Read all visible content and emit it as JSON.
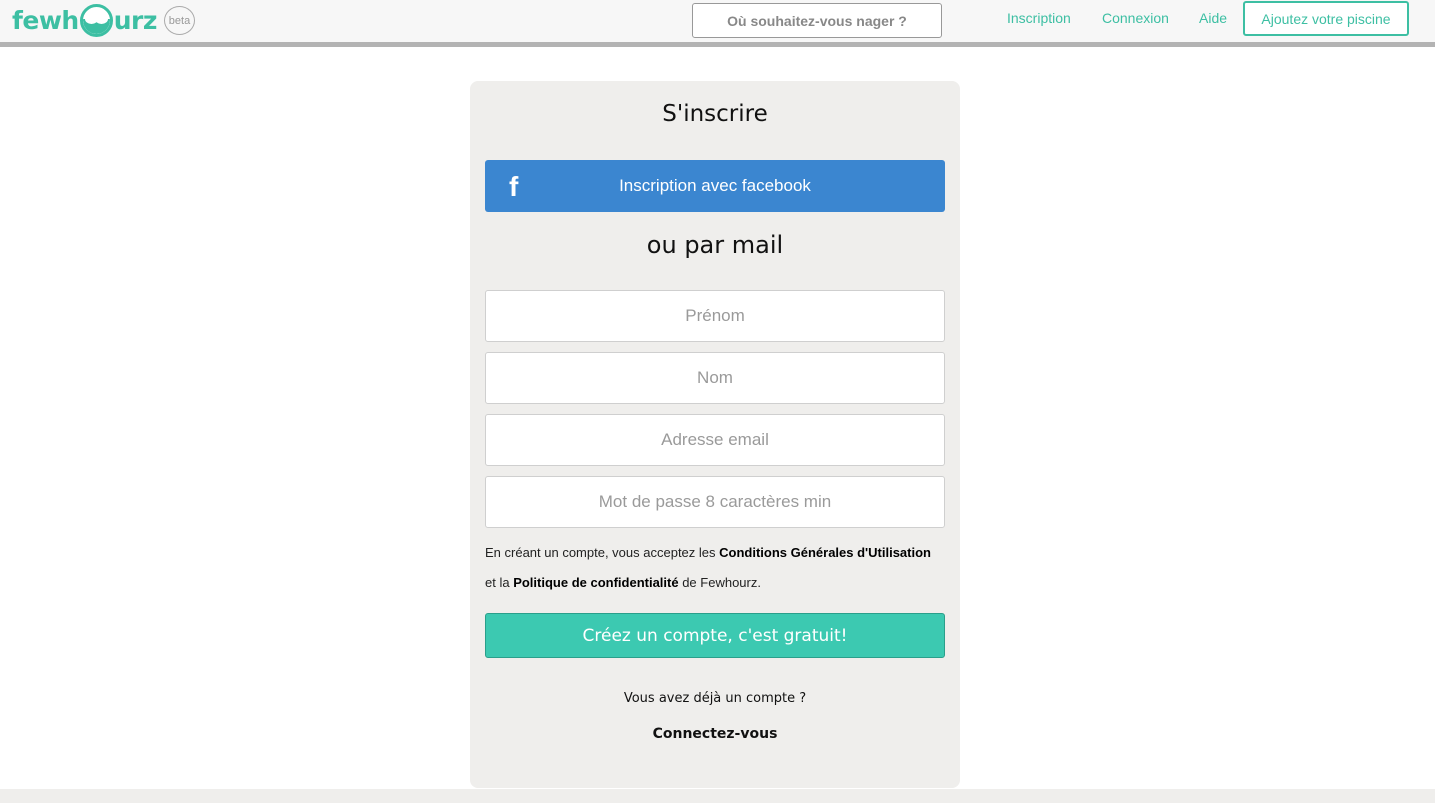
{
  "header": {
    "logo_left": "fewh",
    "logo_right": "urz",
    "beta": "beta",
    "search_placeholder": "Où souhaitez-vous nager ?",
    "nav": {
      "inscription": "Inscription",
      "connexion": "Connexion",
      "aide": "Aide",
      "add_pool": "Ajoutez votre piscine"
    }
  },
  "signup": {
    "title": "S'inscrire",
    "facebook_icon": "f",
    "facebook_label": "Inscription avec facebook",
    "or_mail": "ou par mail",
    "fields": {
      "first_name": "Prénom",
      "last_name": "Nom",
      "email": "Adresse email",
      "password": "Mot de passe 8 caractères min"
    },
    "terms": {
      "prefix": "En créant un compte, vous acceptez les ",
      "cgu": "Conditions Générales d'Utilisation",
      "middle": " et la ",
      "privacy": "Politique de confidentialité",
      "suffix": " de Fewhourz."
    },
    "create_label": "Créez un compte, c'est gratuit!",
    "already": "Vous avez déjà un compte ?",
    "connect": "Connectez-vous"
  },
  "colors": {
    "accent": "#3dbfa3",
    "facebook": "#3b86d0",
    "create_button": "#3cc9b1",
    "card_bg": "#efeeec"
  }
}
